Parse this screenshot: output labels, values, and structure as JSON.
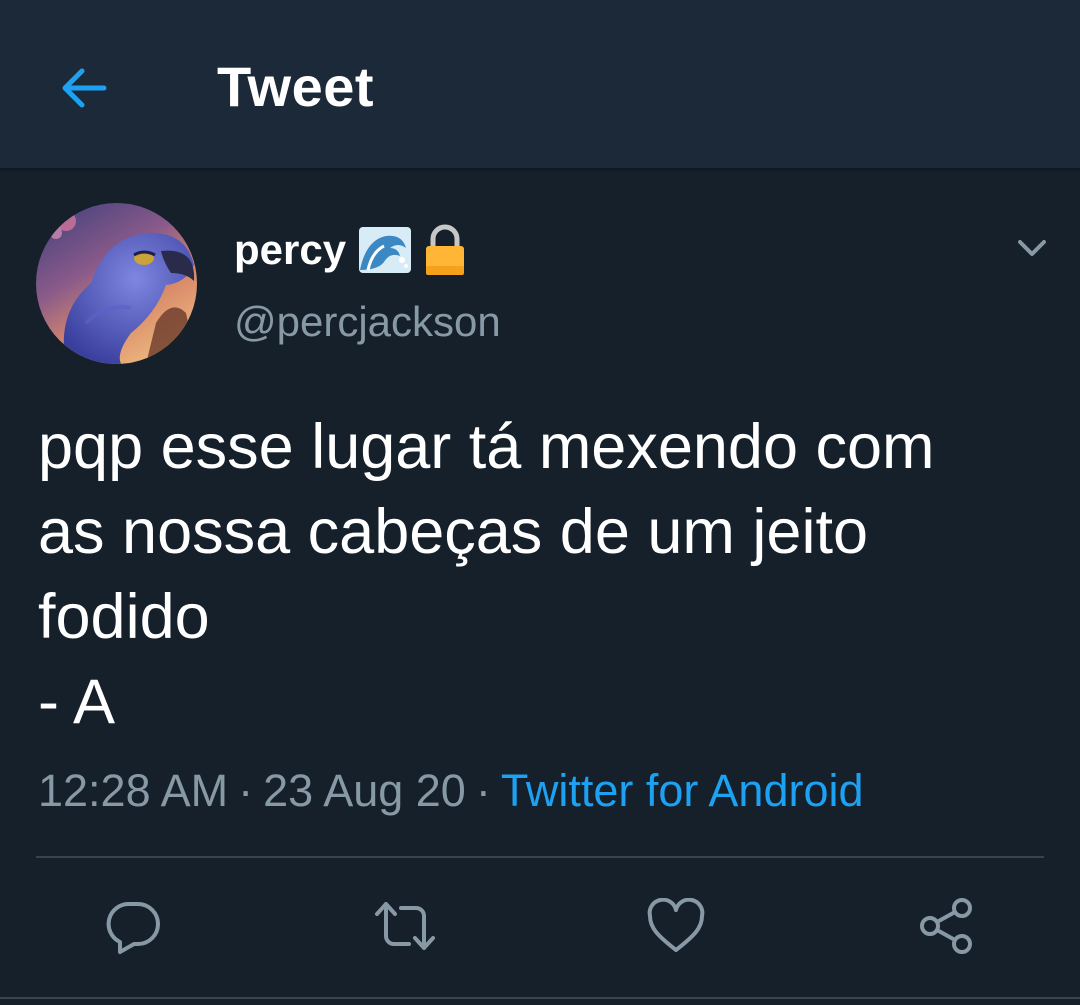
{
  "header": {
    "title": "Tweet"
  },
  "tweet": {
    "author": {
      "display_name": "percy",
      "name_emojis": [
        "wave-emoji",
        "lock-emoji"
      ],
      "handle": "@percjackson"
    },
    "text": "pqp esse lugar tá mexendo com\nas nossa cabeças de um jeito\nfodido\n- A",
    "time": "12:28 AM",
    "date": "23 Aug 20",
    "separator": "·",
    "source": "Twitter for Android"
  },
  "actions": [
    "reply-icon",
    "retweet-icon",
    "like-icon",
    "share-icon"
  ],
  "colors": {
    "background": "#15202b",
    "header_background": "#1c2938",
    "accent": "#1da1f2",
    "secondary_text": "#8899a6",
    "divider": "#38444d"
  }
}
